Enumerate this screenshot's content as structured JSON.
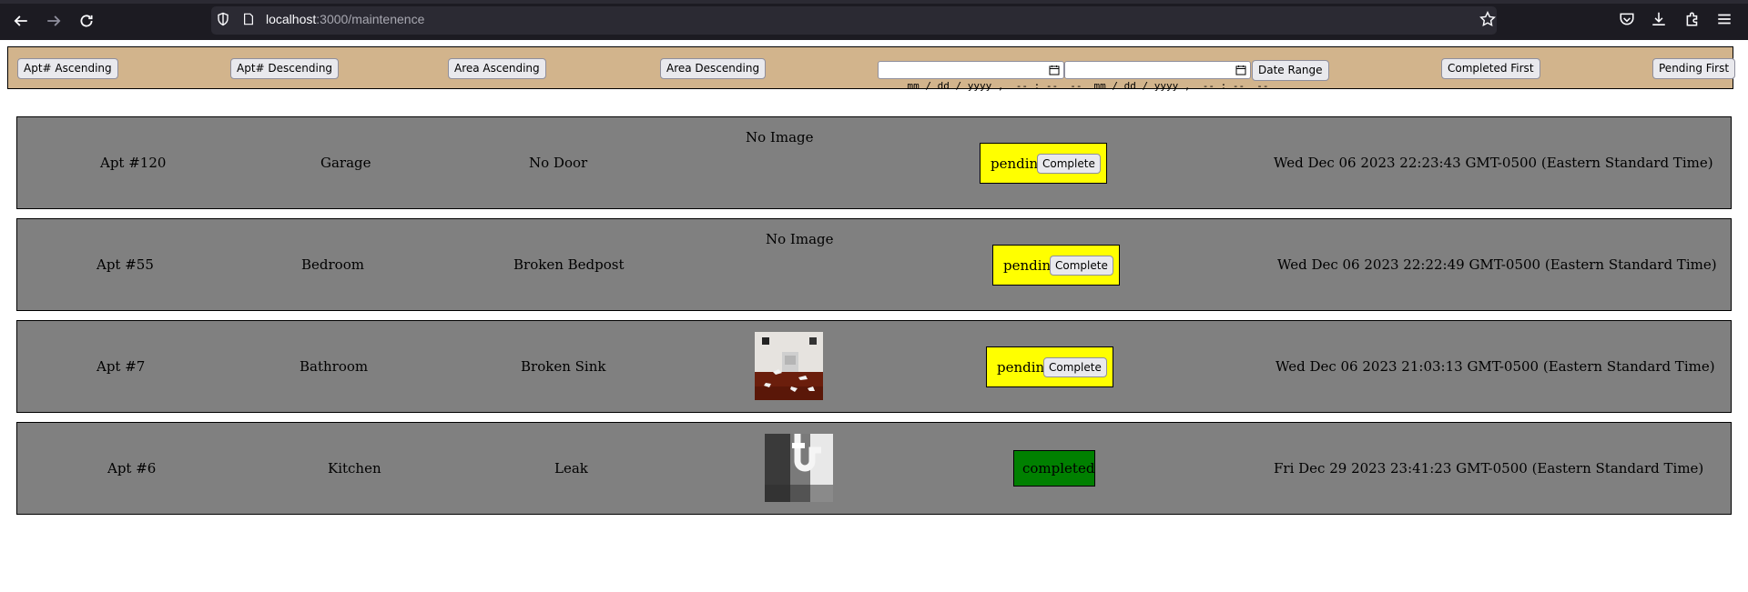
{
  "browser": {
    "url_host": "localhost",
    "url_path": ":3000/maintenence"
  },
  "toolbar": {
    "apt_asc": "Apt# Ascending",
    "apt_desc": "Apt# Descending",
    "area_asc": "Area Ascending",
    "area_desc": "Area Descending",
    "date_start_placeholder": "mm / dd / yyyy ,  -- : --  --",
    "date_end_placeholder": "mm / dd / yyyy ,  -- : --  --",
    "date_range": "Date Range",
    "completed_first": "Completed First",
    "pending_first": "Pending First"
  },
  "requests": [
    {
      "apt": "Apt #120",
      "area": "Garage",
      "issue": "No Door",
      "image_text": "No Image",
      "status": "pending",
      "action": "Complete",
      "date": "Wed Dec 06 2023 22:23:43 GMT-0500 (Eastern Standard Time)"
    },
    {
      "apt": "Apt #55",
      "area": "Bedroom",
      "issue": "Broken Bedpost",
      "image_text": "No Image",
      "status": "pending",
      "action": "Complete",
      "date": "Wed Dec 06 2023 22:22:49 GMT-0500 (Eastern Standard Time)"
    },
    {
      "apt": "Apt #7",
      "area": "Bathroom",
      "issue": "Broken Sink",
      "image": "broken-sink-photo",
      "status": "pending",
      "action": "Complete",
      "date": "Wed Dec 06 2023 21:03:13 GMT-0500 (Eastern Standard Time)"
    },
    {
      "apt": "Apt #6",
      "area": "Kitchen",
      "issue": "Leak",
      "image": "sink-pipe-photo",
      "status": "completed",
      "date": "Fri Dec 29 2023 23:41:23 GMT-0500 (Eastern Standard Time)"
    }
  ],
  "colors": {
    "toolbar_bg": "#d2b48c",
    "row_bg": "#808080",
    "pending": "#ffff00",
    "completed": "#008000"
  }
}
